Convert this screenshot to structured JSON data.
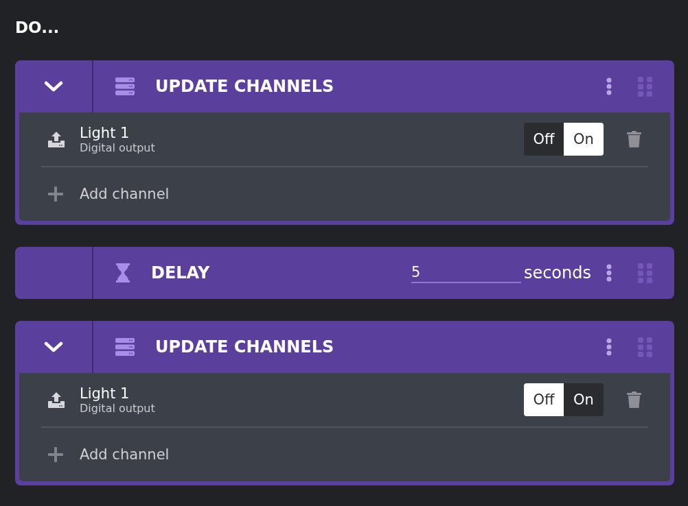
{
  "heading": "DO...",
  "blocks": [
    {
      "kind": "update",
      "expanded": true,
      "title": "UPDATE CHANNELS",
      "channels": [
        {
          "name": "Light 1",
          "type": "Digital output",
          "options": [
            {
              "label": "Off",
              "selected": false
            },
            {
              "label": "On",
              "selected": true
            }
          ]
        }
      ],
      "add_label": "Add channel"
    },
    {
      "kind": "delay",
      "title": "DELAY",
      "value": "5",
      "unit": "seconds"
    },
    {
      "kind": "update",
      "expanded": true,
      "title": "UPDATE CHANNELS",
      "channels": [
        {
          "name": "Light 1",
          "type": "Digital output",
          "options": [
            {
              "label": "Off",
              "selected": true
            },
            {
              "label": "On",
              "selected": false
            }
          ]
        }
      ],
      "add_label": "Add channel"
    }
  ]
}
